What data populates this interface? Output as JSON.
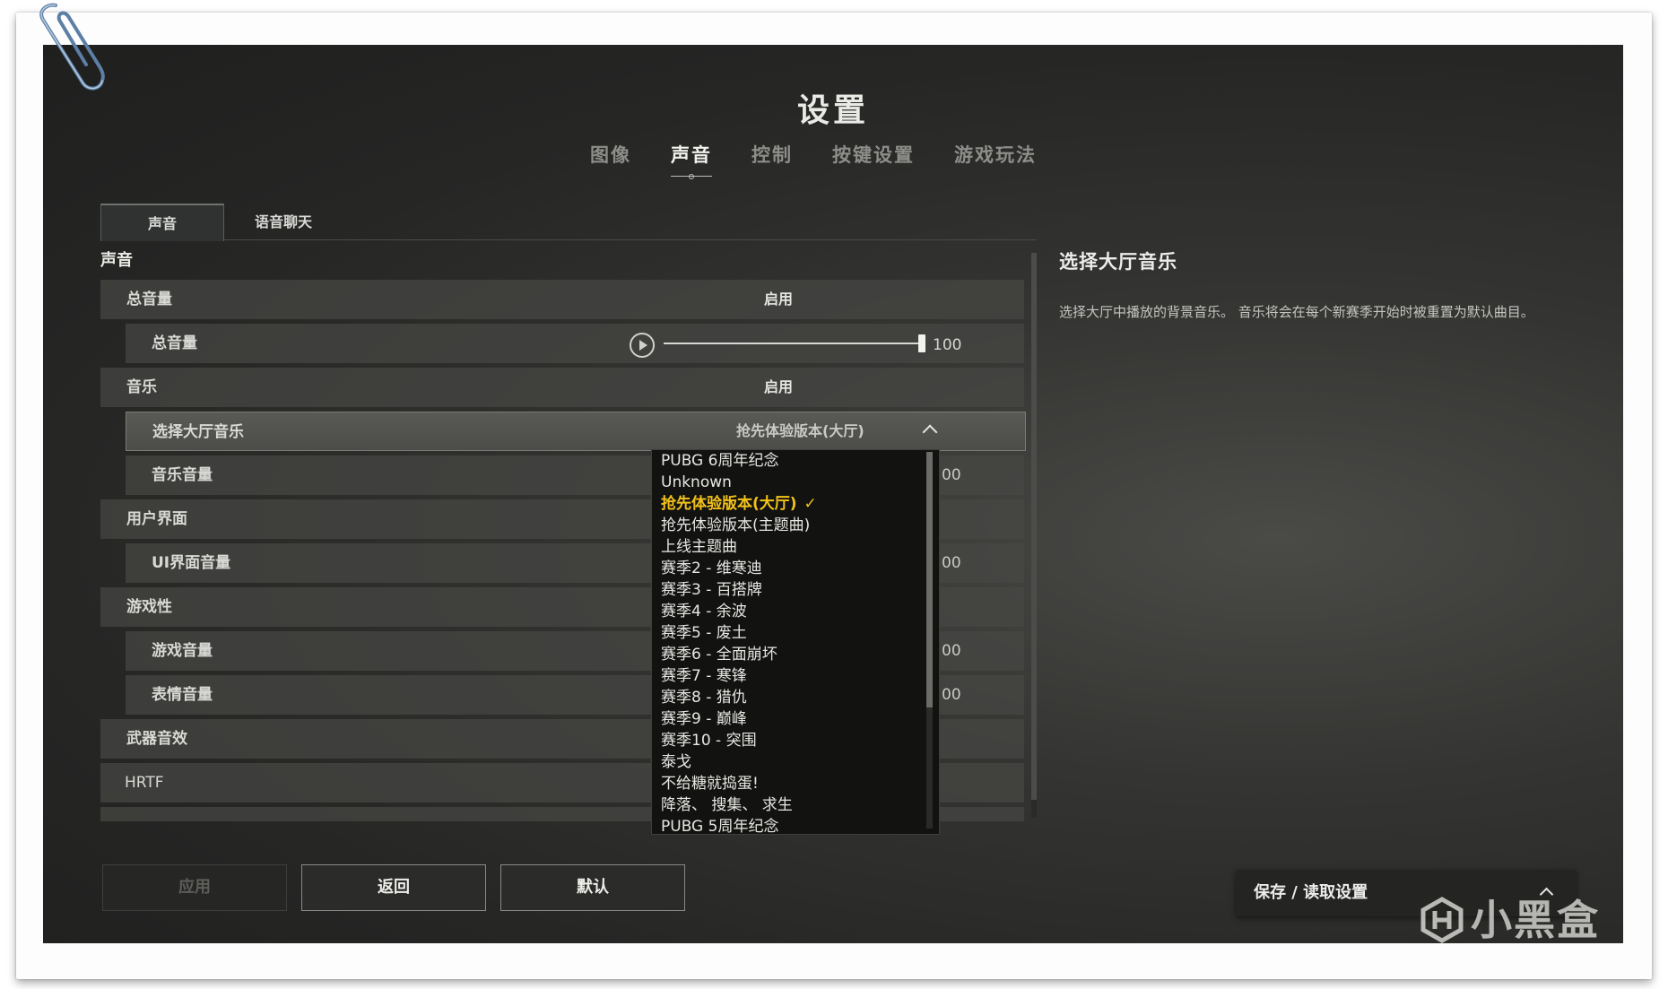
{
  "window": {
    "title": "设置"
  },
  "tabs": [
    {
      "label": "图像",
      "active": false
    },
    {
      "label": "声音",
      "active": true
    },
    {
      "label": "控制",
      "active": false
    },
    {
      "label": "按键设置",
      "active": false
    },
    {
      "label": "游戏玩法",
      "active": false
    }
  ],
  "subtabs": [
    {
      "label": "声音",
      "active": true
    },
    {
      "label": "语音聊天",
      "active": false
    }
  ],
  "section": {
    "label": "声音"
  },
  "rows": {
    "master": {
      "label": "总音量",
      "value": "启用"
    },
    "master_volume": {
      "label": "总音量",
      "value": "100",
      "level_percent": 100
    },
    "music": {
      "label": "音乐",
      "value": "启用"
    },
    "lobby_music": {
      "label": "选择大厅音乐",
      "value": "抢先体验版本(大厅)"
    },
    "music_volume": {
      "label": "音乐音量",
      "tail": "00"
    },
    "ui": {
      "label": "用户界面"
    },
    "ui_volume": {
      "label": "UI界面音量",
      "tail": "00"
    },
    "gameplay": {
      "label": "游戏性"
    },
    "game_volume": {
      "label": "游戏音量",
      "tail": "00"
    },
    "emote_volume": {
      "label": "表情音量",
      "tail": "00"
    },
    "weapon_sfx": {
      "label": "武器音效"
    },
    "hrtf": {
      "label": "HRTF"
    }
  },
  "dropdown": {
    "items": [
      "PUBG 6周年纪念",
      "Unknown",
      "抢先体验版本(大厅)",
      "抢先体验版本(主题曲)",
      "上线主题曲",
      "赛季2 - 维寒迪",
      "赛季3 - 百搭牌",
      "赛季4 - 余波",
      "赛季5 - 废土",
      "赛季6 - 全面崩坏",
      "赛季7 - 寒锋",
      "赛季8 - 猎仇",
      "赛季9 - 巅峰",
      "赛季10 - 突围",
      "泰戈",
      "不给糖就捣蛋!",
      "降落、 搜集、 求生",
      "PUBG 5周年纪念"
    ],
    "selected_index": 2,
    "check_mark": "✓"
  },
  "info": {
    "title": "选择大厅音乐",
    "description": "选择大厅中播放的背景音乐。 音乐将会在每个新赛季开始时被重置为默认曲目。"
  },
  "buttons": {
    "apply": "应用",
    "back": "返回",
    "default": "默认"
  },
  "save_load": {
    "label": "保存 / 读取设置"
  },
  "watermark": {
    "text": "小黑盒"
  },
  "colors": {
    "accent_selected": "#f2c21a",
    "background": "#2a2a29",
    "row": "#464644"
  }
}
